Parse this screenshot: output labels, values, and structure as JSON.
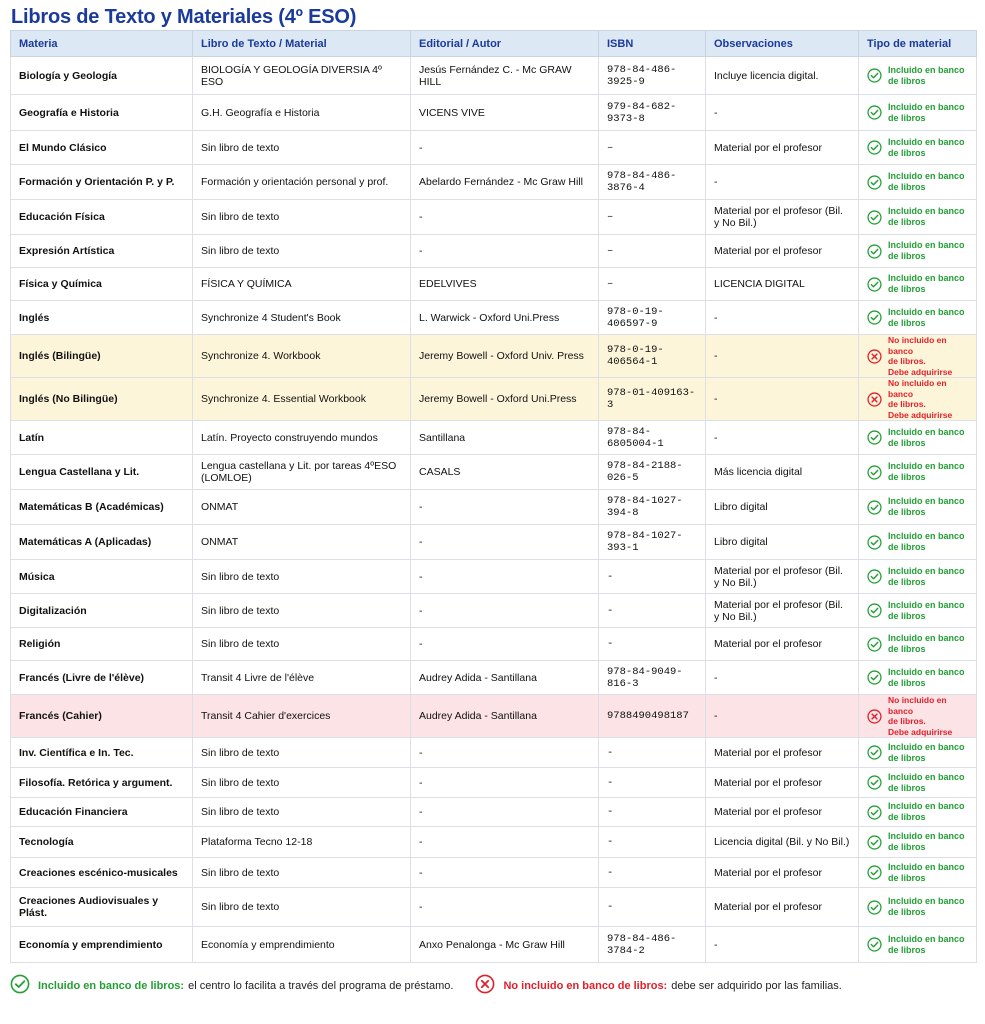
{
  "title": "Libros de Texto y Materiales (4º ESO)",
  "colors": {
    "title": "#1a3a9c",
    "ok": "#22a035",
    "no": "#e0202a",
    "header_bg": "#dde8f5",
    "yellow_row": "#fdf5da",
    "pink_row": "#fbe3e6"
  },
  "headers": [
    "Materia",
    "Libro de Texto / Material",
    "Editorial / Autor",
    "ISBN",
    "Observaciones",
    "Tipo de material"
  ],
  "status": {
    "ok": [
      "Incluido en banco",
      "de libros"
    ],
    "no": [
      "No incluido en banco",
      "de libros.",
      "Debe adquirirse"
    ]
  },
  "rows": [
    {
      "materia": "Biología y Geología",
      "libro": "BIOLOGÍA Y GEOLOGÍA DIVERSIA 4º ESO",
      "editorial": "Jesús Fernández C. - Mc GRAW HILL",
      "isbn": "978-84-486-3925-9",
      "obs": "Incluye licencia digital.",
      "tipo": "ok",
      "h": 38
    },
    {
      "materia": "Geografía e Historia",
      "libro": "G.H. Geografía e Historia",
      "editorial": "VICENS VIVE",
      "isbn": "979-84-682-9373-8",
      "obs": "-",
      "tipo": "ok",
      "h": 36
    },
    {
      "materia": "El Mundo Clásico",
      "libro": "Sin libro de texto",
      "editorial": "-",
      "isbn": "–",
      "obs": "Material por el profesor",
      "tipo": "ok",
      "h": 34
    },
    {
      "materia": "Formación y Orientación P. y P.",
      "libro": "Formación y orientación personal y prof.",
      "editorial": "Abelardo Fernández - Mc Graw Hill",
      "isbn": "978-84-486-3876-4",
      "obs": "-",
      "tipo": "ok",
      "h": 35
    },
    {
      "materia": "Educación Física",
      "libro": "Sin libro de texto",
      "editorial": "-",
      "isbn": "–",
      "obs": "Material por el profesor (Bil. y No Bil.)",
      "tipo": "ok",
      "h": 35
    },
    {
      "materia": "Expresión Artística",
      "libro": "Sin libro de texto",
      "editorial": "-",
      "isbn": "–",
      "obs": "Material por el profesor",
      "tipo": "ok",
      "h": 33
    },
    {
      "materia": "Física y Química",
      "libro": "FÍSICA Y QUÍMICA",
      "editorial": "EDELVIVES",
      "isbn": "–",
      "obs": "LICENCIA DIGITAL",
      "tipo": "ok",
      "h": 33
    },
    {
      "materia": "Inglés",
      "libro": "Synchronize 4 Student's Book",
      "editorial": "L. Warwick - Oxford Uni.Press",
      "isbn": "978-0-19-406597-9",
      "obs": "-",
      "tipo": "ok",
      "h": 34
    },
    {
      "materia": "Inglés (Bilingüe)",
      "libro": "Synchronize 4. Workbook",
      "editorial": "Jeremy Bowell - Oxford Univ. Press",
      "isbn": "978-0-19-406564-1",
      "obs": "-",
      "tipo": "no",
      "row": "yellow",
      "h": 42
    },
    {
      "materia": "Inglés (No Bilingüe)",
      "libro": "Synchronize 4. Essential Workbook",
      "editorial": "Jeremy Bowell - Oxford Uni.Press",
      "isbn": "978-01-409163-3",
      "obs": "-",
      "tipo": "no",
      "row": "yellow",
      "h": 43
    },
    {
      "materia": "Latín",
      "libro": "Latín. Proyecto construyendo mundos",
      "editorial": "Santillana",
      "isbn": "978-84-6805004-1",
      "obs": "-",
      "tipo": "ok",
      "h": 34
    },
    {
      "materia": "Lengua Castellana y Lit.",
      "libro": "Lengua castellana y Lit. por tareas 4ºESO (LOMLOE)",
      "editorial": "CASALS",
      "isbn": "978-84-2188-026-5",
      "obs": "Más licencia digital",
      "tipo": "ok",
      "h": 35
    },
    {
      "materia": "Matemáticas B (Académicas)",
      "libro": "ONMAT",
      "editorial": "-",
      "isbn": "978-84-1027-394-8",
      "obs": "Libro digital",
      "tipo": "ok",
      "h": 35
    },
    {
      "materia": "Matemáticas A (Aplicadas)",
      "libro": "ONMAT",
      "editorial": "-",
      "isbn": "978-84-1027-393-1",
      "obs": "Libro digital",
      "tipo": "ok",
      "h": 35
    },
    {
      "materia": "Música",
      "libro": "Sin libro de texto",
      "editorial": "-",
      "isbn": "-",
      "obs": "Material por el profesor (Bil. y No Bil.)",
      "tipo": "ok",
      "h": 34
    },
    {
      "materia": "Digitalización",
      "libro": "Sin libro de texto",
      "editorial": "-",
      "isbn": "-",
      "obs": "Material por el profesor (Bil. y No Bil.)",
      "tipo": "ok",
      "h": 34
    },
    {
      "materia": "Religión",
      "libro": "Sin libro de texto",
      "editorial": "-",
      "isbn": "-",
      "obs": "Material por el profesor",
      "tipo": "ok",
      "h": 33
    },
    {
      "materia": "Francés (Livre de l'élève)",
      "libro": "Transit 4 Livre de l'élève",
      "editorial": "Audrey Adida - Santillana",
      "isbn": "978-84-9049-816-3",
      "obs": "-",
      "tipo": "ok",
      "h": 34
    },
    {
      "materia": "Francés (Cahier)",
      "libro": "Transit 4 Cahier d'exercices",
      "editorial": "Audrey Adida - Santillana",
      "isbn": "9788490498187",
      "obs": "-",
      "tipo": "no",
      "row": "pink",
      "h": 41
    },
    {
      "materia": "Inv. Científica e In. Tec.",
      "libro": "Sin libro de texto",
      "editorial": "-",
      "isbn": "-",
      "obs": "Material por el profesor",
      "tipo": "ok",
      "h": 30
    },
    {
      "materia": "Filosofía. Retórica y argument.",
      "libro": "Sin libro de texto",
      "editorial": "-",
      "isbn": "-",
      "obs": "Material por el profesor",
      "tipo": "ok",
      "h": 30
    },
    {
      "materia": "Educación Financiera",
      "libro": "Sin libro de texto",
      "editorial": "-",
      "isbn": "-",
      "obs": "Material por el profesor",
      "tipo": "ok",
      "h": 29
    },
    {
      "materia": "Tecnología",
      "libro": "Plataforma Tecno 12-18",
      "editorial": "-",
      "isbn": "-",
      "obs": "Licencia digital (Bil. y No Bil.)",
      "tipo": "ok",
      "h": 31
    },
    {
      "materia": "Creaciones escénico-musicales",
      "libro": "Sin libro de texto",
      "editorial": "-",
      "isbn": "-",
      "obs": "Material por el profesor",
      "tipo": "ok",
      "h": 30
    },
    {
      "materia": "Creaciones Audiovisuales y Plást.",
      "libro": "Sin libro de texto",
      "editorial": "-",
      "isbn": "-",
      "obs": "Material por el profesor",
      "tipo": "ok",
      "h": 39
    },
    {
      "materia": "Economía y emprendimiento",
      "libro": "Economía y emprendimiento",
      "editorial": "Anxo Penalonga - Mc Graw Hill",
      "isbn": "978-84-486-3784-2",
      "obs": "-",
      "tipo": "ok",
      "h": 36
    }
  ],
  "legend": {
    "ok_label": "Incluido en banco de libros:",
    "ok_desc": "el centro lo facilita a través del programa de préstamo.",
    "no_label": "No incluido en banco de libros:",
    "no_desc": "debe ser adquirido por las familias."
  }
}
